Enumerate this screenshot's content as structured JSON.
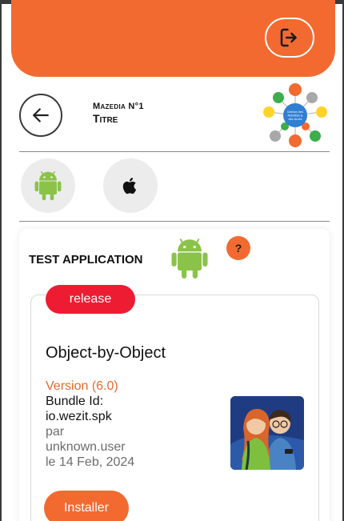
{
  "header": {
    "subtitle": "Mazedia N°1",
    "title": "Titre",
    "logo_text": "Gestion des Mobilités & des Accès"
  },
  "platforms": [
    {
      "name": "android",
      "icon": "android-icon"
    },
    {
      "name": "apple",
      "icon": "apple-icon"
    }
  ],
  "app": {
    "name": "TEST APPLICATION",
    "help": "?",
    "release_label": "release",
    "title": "Object-by-Object",
    "version": "Version (6.0)",
    "bundle_label": "Bundle Id:",
    "bundle_id": "io.wezit.spk",
    "par": "par",
    "user": "unknown.user",
    "date": "le 14 Feb, 2024",
    "install_label": "Installer"
  },
  "colors": {
    "accent": "#f26a30",
    "release": "#ee1c32",
    "android": "#8bc34a"
  }
}
